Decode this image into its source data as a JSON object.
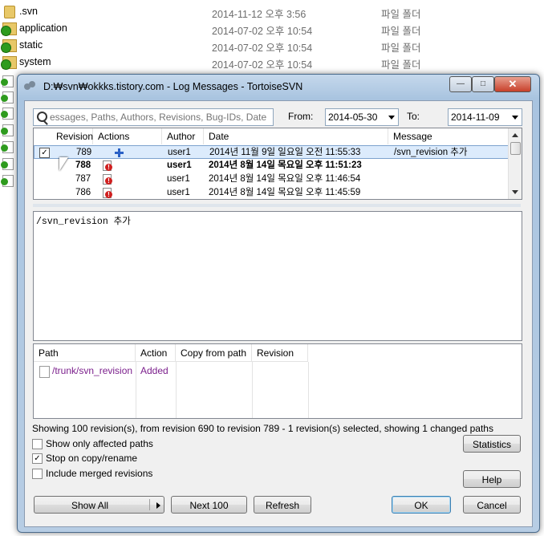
{
  "explorer": {
    "rows": [
      {
        "name": ".svn",
        "date": "2014-11-12 오후 3:56",
        "type": "파일 폴더",
        "icon": "folder"
      },
      {
        "name": "application",
        "date": "2014-07-02 오후 10:54",
        "type": "파일 폴더",
        "icon": "svn-ok"
      },
      {
        "name": "static",
        "date": "2014-07-02 오후 10:54",
        "type": "파일 폴더",
        "icon": "svn-ok"
      },
      {
        "name": "system",
        "date": "2014-07-02 오후 10:54",
        "type": "파일 폴더",
        "icon": "svn-ok"
      }
    ]
  },
  "dialog": {
    "title": "D:₩svn₩okkks.tistory.com - Log Messages - TortoiseSVN",
    "window_buttons": {
      "minimize": "—",
      "maximize": "□",
      "close": "✕"
    },
    "search": {
      "placeholder": "essages, Paths, Authors, Revisions, Bug-IDs, Date,"
    },
    "from_label": "From:",
    "from_value": "2014-05-30",
    "to_label": "To:",
    "to_value": "2014-11-09",
    "log_headers": [
      "Revision",
      "Actions",
      "Author",
      "Date",
      "Message"
    ],
    "log_rows": [
      {
        "revision": "789",
        "action": "added",
        "author": "user1",
        "date": "2014년 11월 9일 일요일 오전 11:55:33",
        "message": "/svn_revision 추가",
        "selected": true,
        "checked": "✓"
      },
      {
        "revision": "788",
        "action": "modified",
        "author": "user1",
        "date": "2014년 8월 14일 목요일 오후 11:51:23",
        "message": "",
        "bold": true
      },
      {
        "revision": "787",
        "action": "modified",
        "author": "user1",
        "date": "2014년 8월 14일 목요일 오후 11:46:54",
        "message": ""
      },
      {
        "revision": "786",
        "action": "modified",
        "author": "user1",
        "date": "2014년 8월 14일 목요일 오후 11:45:59",
        "message": ""
      }
    ],
    "message_text": "/svn_revision 추가",
    "path_headers": [
      "Path",
      "Action",
      "Copy from path",
      "Revision"
    ],
    "paths": [
      {
        "path": "/trunk/svn_revision",
        "action": "Added",
        "copy_from": "",
        "revision": ""
      }
    ],
    "status": "Showing 100 revision(s), from revision 690 to revision 789 - 1 revision(s) selected, showing 1 changed paths",
    "options": [
      {
        "label": "Show only affected paths",
        "checked": ""
      },
      {
        "label": "Stop on copy/rename",
        "checked": "✓"
      },
      {
        "label": "Include merged revisions",
        "checked": ""
      }
    ],
    "buttons": {
      "statistics": "Statistics",
      "help": "Help",
      "show_all": "Show All",
      "next_100": "Next 100",
      "refresh": "Refresh",
      "ok": "OK",
      "cancel": "Cancel"
    }
  }
}
